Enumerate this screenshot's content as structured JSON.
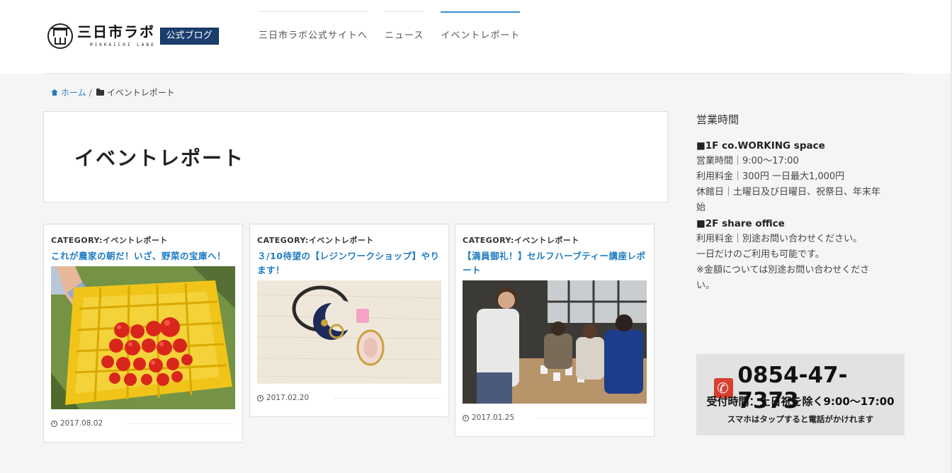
{
  "header": {
    "logo_name": "三日市ラボ",
    "logo_sub": "MIKKAICHI LABO",
    "logo_badge": "公式ブログ",
    "nav": [
      {
        "label": "三日市ラボ公式サイトへ"
      },
      {
        "label": "ニュース"
      },
      {
        "label": "イベントレポート"
      }
    ]
  },
  "breadcrumb": {
    "home": "ホーム",
    "separator": "/",
    "current": "イベントレポート"
  },
  "page": {
    "title": "イベントレポート"
  },
  "cards": [
    {
      "category": "CATEGORY:イベントレポート",
      "title": "これが農家の朝だ！いざ、野菜の宝庫へ！",
      "date": "2017.08.02"
    },
    {
      "category": "CATEGORY:イベントレポート",
      "title": "３/10待望の【レジンワークショップ】やります！",
      "date": "2017.02.20"
    },
    {
      "category": "CATEGORY:イベントレポート",
      "title": "【満員御礼！】セルフハーブティー講座レポート",
      "date": "2017.01.25"
    }
  ],
  "sidebar": {
    "heading": "営業時間",
    "lines": [
      {
        "text": "■1F co.WORKING space",
        "bold": true
      },
      {
        "text": "営業時間｜9:00〜17:00",
        "bold": false
      },
      {
        "text": "利用料金｜300円 一日最大1,000円",
        "bold": false
      },
      {
        "text": "休館日｜土曜日及び日曜日、祝祭日、年末年",
        "bold": false
      },
      {
        "text": "始",
        "bold": false
      },
      {
        "text": "■2F share office",
        "bold": true
      },
      {
        "text": "利用料金｜別途お問い合わせください。",
        "bold": false
      },
      {
        "text": "一日だけのご利用も可能です。",
        "bold": false
      },
      {
        "text": "※金額については別途お問い合わせくださ",
        "bold": false
      },
      {
        "text": "い。",
        "bold": false
      }
    ],
    "phone": {
      "number": "0854-47-7373",
      "hours": "受付時間：土日祝を除く9:00〜17:00",
      "note": "スマホはタップすると電話がかけれます"
    }
  },
  "colors": {
    "link": "#1f7bc1",
    "badge": "#1a3e6e",
    "nav_active": "#3a8fd0",
    "phone_icon": "#d83f30"
  }
}
